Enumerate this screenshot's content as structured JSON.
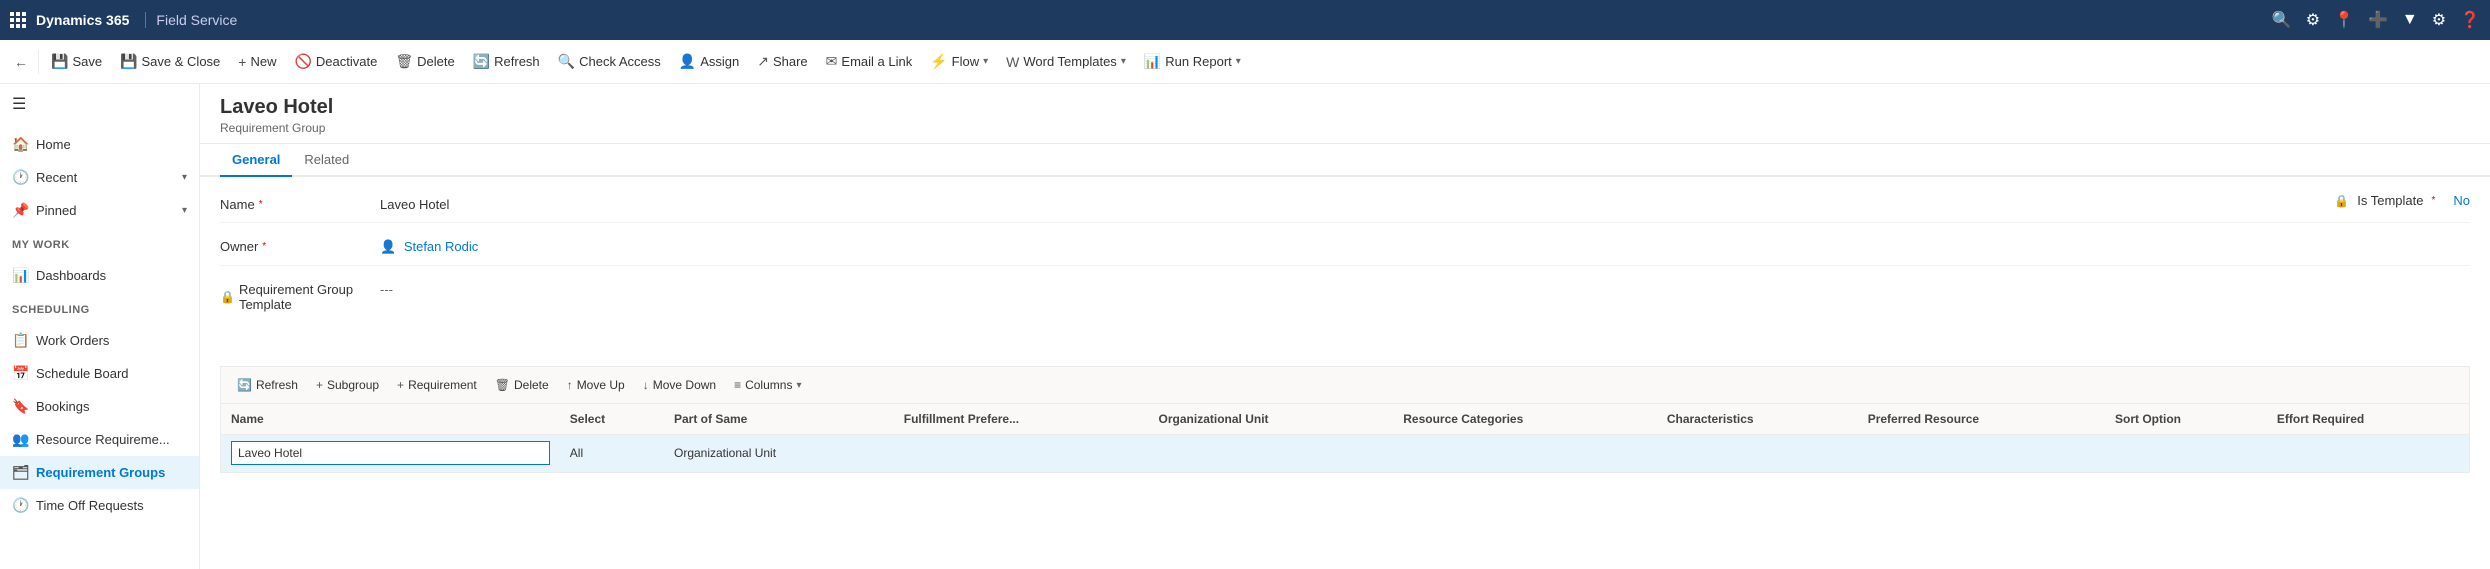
{
  "topbar": {
    "brand": "Dynamics 365",
    "app": "Field Service",
    "icons": [
      "search",
      "settings-circle",
      "location",
      "plus",
      "filter",
      "gear",
      "question"
    ]
  },
  "commandbar": {
    "back_label": "←",
    "buttons": [
      {
        "id": "save",
        "icon": "💾",
        "label": "Save"
      },
      {
        "id": "save-close",
        "icon": "💾",
        "label": "Save & Close"
      },
      {
        "id": "new",
        "icon": "+",
        "label": "New"
      },
      {
        "id": "deactivate",
        "icon": "🚫",
        "label": "Deactivate"
      },
      {
        "id": "delete",
        "icon": "🗑",
        "label": "Delete"
      },
      {
        "id": "refresh",
        "icon": "🔄",
        "label": "Refresh"
      },
      {
        "id": "check-access",
        "icon": "🔍",
        "label": "Check Access"
      },
      {
        "id": "assign",
        "icon": "👤",
        "label": "Assign"
      },
      {
        "id": "share",
        "icon": "↗",
        "label": "Share"
      },
      {
        "id": "email-link",
        "icon": "✉",
        "label": "Email a Link"
      },
      {
        "id": "flow",
        "icon": "⚡",
        "label": "Flow",
        "dropdown": true
      },
      {
        "id": "word-templates",
        "icon": "W",
        "label": "Word Templates",
        "dropdown": true
      },
      {
        "id": "run-report",
        "icon": "📊",
        "label": "Run Report",
        "dropdown": true
      }
    ]
  },
  "sidebar": {
    "hamburger": "☰",
    "sections": [
      {
        "items": [
          {
            "id": "home",
            "icon": "🏠",
            "label": "Home"
          },
          {
            "id": "recent",
            "icon": "🕐",
            "label": "Recent",
            "expand": true
          },
          {
            "id": "pinned",
            "icon": "📌",
            "label": "Pinned",
            "expand": true
          }
        ]
      },
      {
        "label": "My Work",
        "items": [
          {
            "id": "dashboards",
            "icon": "📊",
            "label": "Dashboards"
          }
        ]
      },
      {
        "label": "Scheduling",
        "items": [
          {
            "id": "work-orders",
            "icon": "📋",
            "label": "Work Orders"
          },
          {
            "id": "schedule-board",
            "icon": "📅",
            "label": "Schedule Board"
          },
          {
            "id": "bookings",
            "icon": "🔖",
            "label": "Bookings"
          },
          {
            "id": "resource-requirements",
            "icon": "👥",
            "label": "Resource Requireme..."
          },
          {
            "id": "requirement-groups",
            "icon": "🗂",
            "label": "Requirement Groups",
            "active": true
          },
          {
            "id": "time-off-requests",
            "icon": "🕐",
            "label": "Time Off Requests"
          }
        ]
      }
    ]
  },
  "form": {
    "title": "Laveo Hotel",
    "subtitle": "Requirement Group",
    "tabs": [
      {
        "id": "general",
        "label": "General",
        "active": true
      },
      {
        "id": "related",
        "label": "Related"
      }
    ],
    "fields": {
      "name_label": "Name",
      "name_value": "Laveo Hotel",
      "owner_label": "Owner",
      "owner_value": "Stefan Rodic",
      "req_group_template_label": "Requirement Group Template",
      "req_group_template_value": "---",
      "is_template_label": "Is Template",
      "is_template_value": "No"
    }
  },
  "subgrid": {
    "toolbar_buttons": [
      {
        "id": "refresh",
        "icon": "🔄",
        "label": "Refresh"
      },
      {
        "id": "subgroup",
        "icon": "+",
        "label": "Subgroup"
      },
      {
        "id": "requirement",
        "icon": "+",
        "label": "Requirement"
      },
      {
        "id": "delete",
        "icon": "🗑",
        "label": "Delete"
      },
      {
        "id": "move-up",
        "icon": "↑",
        "label": "Move Up"
      },
      {
        "id": "move-down",
        "icon": "↓",
        "label": "Move Down"
      },
      {
        "id": "columns",
        "icon": "≡",
        "label": "Columns",
        "dropdown": true
      }
    ],
    "columns": [
      {
        "id": "name",
        "label": "Name"
      },
      {
        "id": "select",
        "label": "Select"
      },
      {
        "id": "part-of-same",
        "label": "Part of Same"
      },
      {
        "id": "fulfillment-pref",
        "label": "Fulfillment Prefere..."
      },
      {
        "id": "org-unit",
        "label": "Organizational Unit"
      },
      {
        "id": "resource-categories",
        "label": "Resource Categories"
      },
      {
        "id": "characteristics",
        "label": "Characteristics"
      },
      {
        "id": "preferred-resource",
        "label": "Preferred Resource"
      },
      {
        "id": "sort-option",
        "label": "Sort Option"
      },
      {
        "id": "effort-required",
        "label": "Effort Required"
      }
    ],
    "rows": [
      {
        "name": "Laveo Hotel",
        "name_editable": true,
        "select": "All",
        "part_of_same": "Organizational Unit",
        "fulfillment_pref": "",
        "org_unit": "",
        "resource_categories": "",
        "characteristics": "",
        "preferred_resource": "",
        "sort_option": "",
        "effort_required": ""
      }
    ]
  }
}
